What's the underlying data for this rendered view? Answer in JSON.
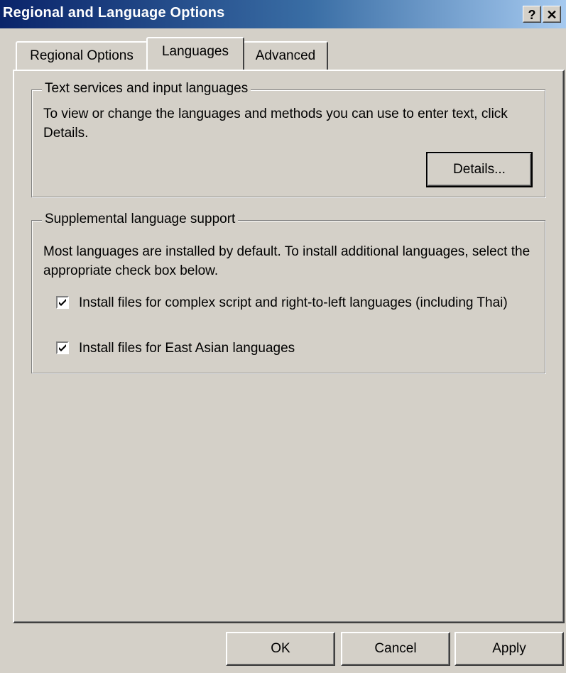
{
  "window": {
    "title": "Regional and Language Options",
    "help_button": "?",
    "close_button": "✕"
  },
  "tabs": [
    {
      "label": "Regional Options"
    },
    {
      "label": "Languages"
    },
    {
      "label": "Advanced"
    }
  ],
  "text_services": {
    "title": "Text services and input languages",
    "description": "To view or change the languages and methods you can use to enter text, click Details.",
    "details_button": "Details..."
  },
  "supplemental": {
    "title": "Supplemental language support",
    "description": "Most languages are installed by default. To install additional languages, select the appropriate check box below.",
    "checkboxes": [
      {
        "label": "Install files for complex script and right-to-left languages (including Thai)",
        "checked": true
      },
      {
        "label": "Install files for East Asian languages",
        "checked": true
      }
    ]
  },
  "footer": {
    "ok": "OK",
    "cancel": "Cancel",
    "apply": "Apply"
  }
}
